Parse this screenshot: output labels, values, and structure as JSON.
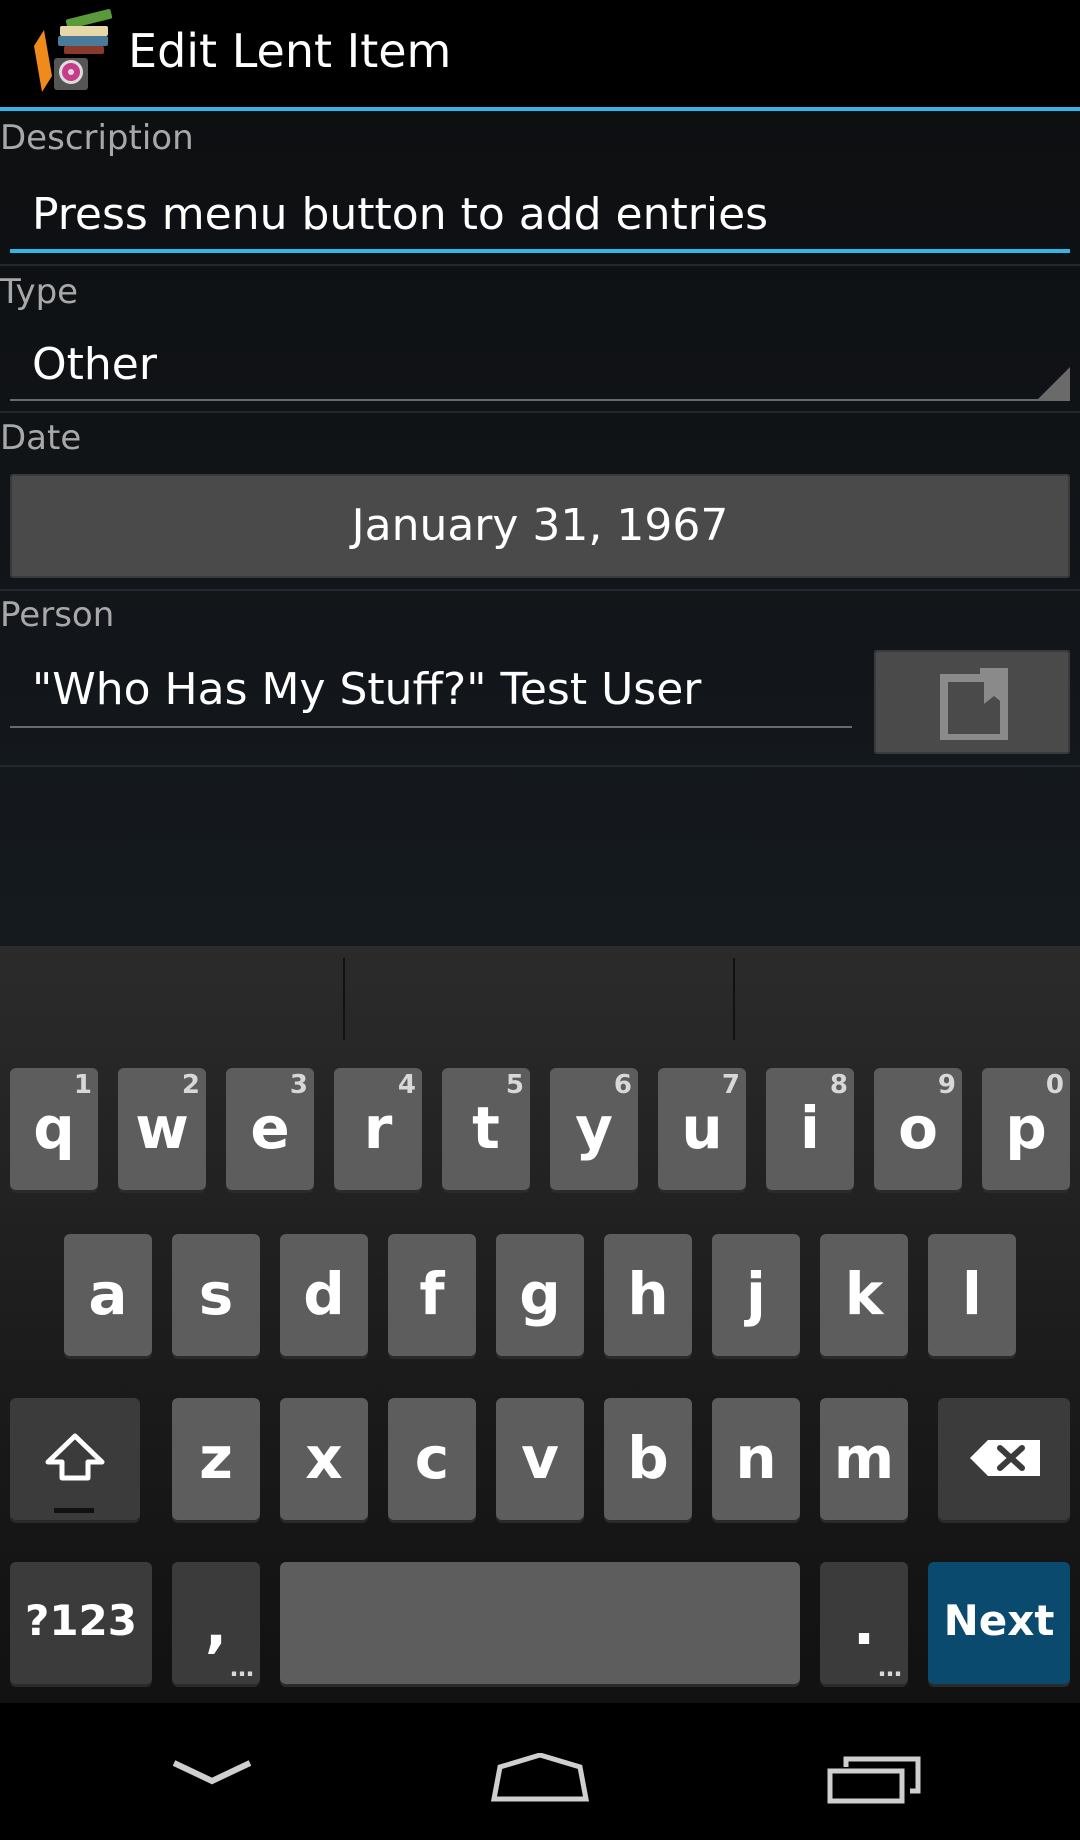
{
  "action_bar": {
    "title": "Edit Lent Item",
    "icon": "app-books-icon"
  },
  "form": {
    "description": {
      "label": "Description",
      "value": "Press menu button to add entries"
    },
    "type": {
      "label": "Type",
      "value": "Other"
    },
    "date": {
      "label": "Date",
      "value": "January 31, 1967"
    },
    "person": {
      "label": "Person",
      "value": "\"Who Has My Stuff?\" Test User",
      "contact_icon": "contact-picker-icon"
    }
  },
  "keyboard": {
    "row1": [
      {
        "key": "q",
        "sup": "1"
      },
      {
        "key": "w",
        "sup": "2"
      },
      {
        "key": "e",
        "sup": "3"
      },
      {
        "key": "r",
        "sup": "4"
      },
      {
        "key": "t",
        "sup": "5"
      },
      {
        "key": "y",
        "sup": "6"
      },
      {
        "key": "u",
        "sup": "7"
      },
      {
        "key": "i",
        "sup": "8"
      },
      {
        "key": "o",
        "sup": "9"
      },
      {
        "key": "p",
        "sup": "0"
      }
    ],
    "row2": [
      "a",
      "s",
      "d",
      "f",
      "g",
      "h",
      "j",
      "k",
      "l"
    ],
    "row3": [
      "z",
      "x",
      "c",
      "v",
      "b",
      "n",
      "m"
    ],
    "symbols_label": "?123",
    "comma_label": ",",
    "period_label": ".",
    "next_label": "Next",
    "shift_icon": "shift-icon",
    "backspace_icon": "backspace-icon"
  },
  "nav": {
    "back_icon": "back-icon",
    "home_icon": "home-icon",
    "recents_icon": "recents-icon"
  },
  "colors": {
    "accent": "#33b5e5",
    "next_key": "#0a4a6e"
  }
}
